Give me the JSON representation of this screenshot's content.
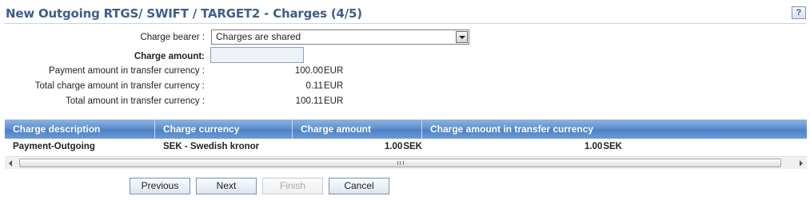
{
  "header": {
    "title": "New Outgoing RTGS/ SWIFT / TARGET2 - Charges (4/5)",
    "help_label": "?"
  },
  "form": {
    "charge_bearer_label": "Charge bearer :",
    "charge_bearer_value": "Charges are shared",
    "charge_amount_label": "Charge amount:",
    "charge_amount_value": "",
    "payment_amount_label": "Payment amount in transfer currency :",
    "payment_amount_value": "100.00",
    "payment_amount_currency": "EUR",
    "total_charge_label": "Total charge amount in transfer currency :",
    "total_charge_value": "0.11",
    "total_charge_currency": "EUR",
    "total_amount_label": "Total amount in transfer currency :",
    "total_amount_value": "100.11",
    "total_amount_currency": "EUR"
  },
  "table": {
    "columns": [
      "Charge description",
      "Charge currency",
      "Charge amount",
      "Charge amount in transfer currency"
    ],
    "rows": [
      {
        "description": "Payment-Outgoing",
        "currency": "SEK - Swedish kronor",
        "amount": "1.00",
        "amount_currency": "SEK",
        "transfer_amount": "1.00",
        "transfer_currency": "SEK"
      }
    ]
  },
  "buttons": {
    "previous": "Previous",
    "next": "Next",
    "finish": "Finish",
    "cancel": "Cancel"
  },
  "colors": {
    "title": "#3f5e8c",
    "grid_header": "#5c8fd0"
  }
}
